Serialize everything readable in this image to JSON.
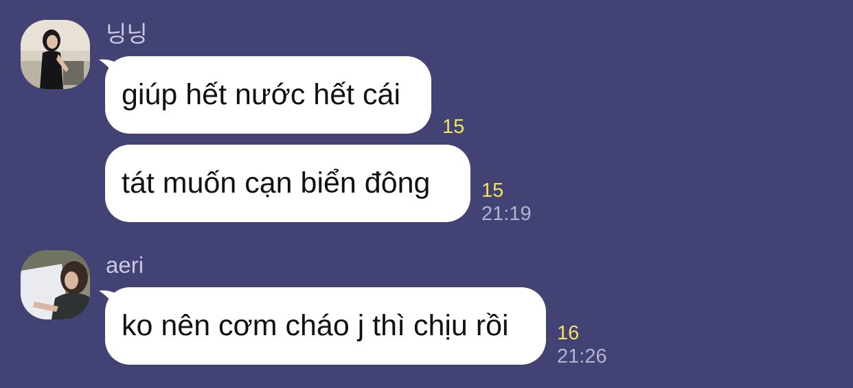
{
  "theme": {
    "background": "#434274",
    "bubble": "#ffffff",
    "unread_color": "#f4e35c",
    "time_color": "#b4b3d0",
    "name_color": "#c9c8e2"
  },
  "chat": {
    "groups": [
      {
        "sender": "닝닝",
        "avatar_icon": "user-avatar-photo",
        "messages": [
          {
            "text": "giúp hết nước hết cái",
            "unread": "15",
            "time": ""
          },
          {
            "text": "tát muốn cạn biển đông",
            "unread": "15",
            "time": "21:19"
          }
        ]
      },
      {
        "sender": "aeri",
        "avatar_icon": "user-avatar-photo",
        "messages": [
          {
            "text": "ko nên cơm cháo j thì chịu rồi",
            "unread": "16",
            "time": "21:26"
          }
        ]
      }
    ]
  }
}
